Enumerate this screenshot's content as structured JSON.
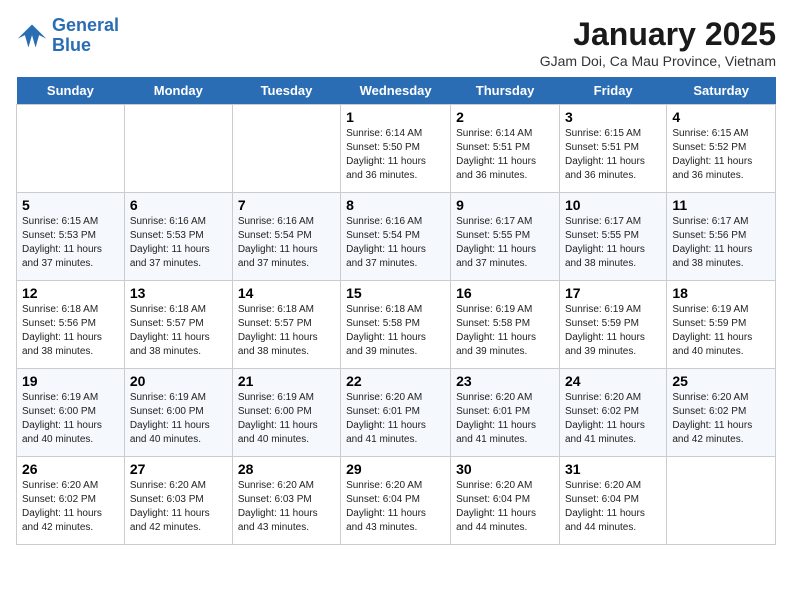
{
  "logo": {
    "line1": "General",
    "line2": "Blue"
  },
  "title": "January 2025",
  "location": "GJam Doi, Ca Mau Province, Vietnam",
  "headers": [
    "Sunday",
    "Monday",
    "Tuesday",
    "Wednesday",
    "Thursday",
    "Friday",
    "Saturday"
  ],
  "weeks": [
    [
      {
        "day": "",
        "text": ""
      },
      {
        "day": "",
        "text": ""
      },
      {
        "day": "",
        "text": ""
      },
      {
        "day": "1",
        "text": "Sunrise: 6:14 AM\nSunset: 5:50 PM\nDaylight: 11 hours and 36 minutes."
      },
      {
        "day": "2",
        "text": "Sunrise: 6:14 AM\nSunset: 5:51 PM\nDaylight: 11 hours and 36 minutes."
      },
      {
        "day": "3",
        "text": "Sunrise: 6:15 AM\nSunset: 5:51 PM\nDaylight: 11 hours and 36 minutes."
      },
      {
        "day": "4",
        "text": "Sunrise: 6:15 AM\nSunset: 5:52 PM\nDaylight: 11 hours and 36 minutes."
      }
    ],
    [
      {
        "day": "5",
        "text": "Sunrise: 6:15 AM\nSunset: 5:53 PM\nDaylight: 11 hours and 37 minutes."
      },
      {
        "day": "6",
        "text": "Sunrise: 6:16 AM\nSunset: 5:53 PM\nDaylight: 11 hours and 37 minutes."
      },
      {
        "day": "7",
        "text": "Sunrise: 6:16 AM\nSunset: 5:54 PM\nDaylight: 11 hours and 37 minutes."
      },
      {
        "day": "8",
        "text": "Sunrise: 6:16 AM\nSunset: 5:54 PM\nDaylight: 11 hours and 37 minutes."
      },
      {
        "day": "9",
        "text": "Sunrise: 6:17 AM\nSunset: 5:55 PM\nDaylight: 11 hours and 37 minutes."
      },
      {
        "day": "10",
        "text": "Sunrise: 6:17 AM\nSunset: 5:55 PM\nDaylight: 11 hours and 38 minutes."
      },
      {
        "day": "11",
        "text": "Sunrise: 6:17 AM\nSunset: 5:56 PM\nDaylight: 11 hours and 38 minutes."
      }
    ],
    [
      {
        "day": "12",
        "text": "Sunrise: 6:18 AM\nSunset: 5:56 PM\nDaylight: 11 hours and 38 minutes."
      },
      {
        "day": "13",
        "text": "Sunrise: 6:18 AM\nSunset: 5:57 PM\nDaylight: 11 hours and 38 minutes."
      },
      {
        "day": "14",
        "text": "Sunrise: 6:18 AM\nSunset: 5:57 PM\nDaylight: 11 hours and 38 minutes."
      },
      {
        "day": "15",
        "text": "Sunrise: 6:18 AM\nSunset: 5:58 PM\nDaylight: 11 hours and 39 minutes."
      },
      {
        "day": "16",
        "text": "Sunrise: 6:19 AM\nSunset: 5:58 PM\nDaylight: 11 hours and 39 minutes."
      },
      {
        "day": "17",
        "text": "Sunrise: 6:19 AM\nSunset: 5:59 PM\nDaylight: 11 hours and 39 minutes."
      },
      {
        "day": "18",
        "text": "Sunrise: 6:19 AM\nSunset: 5:59 PM\nDaylight: 11 hours and 40 minutes."
      }
    ],
    [
      {
        "day": "19",
        "text": "Sunrise: 6:19 AM\nSunset: 6:00 PM\nDaylight: 11 hours and 40 minutes."
      },
      {
        "day": "20",
        "text": "Sunrise: 6:19 AM\nSunset: 6:00 PM\nDaylight: 11 hours and 40 minutes."
      },
      {
        "day": "21",
        "text": "Sunrise: 6:19 AM\nSunset: 6:00 PM\nDaylight: 11 hours and 40 minutes."
      },
      {
        "day": "22",
        "text": "Sunrise: 6:20 AM\nSunset: 6:01 PM\nDaylight: 11 hours and 41 minutes."
      },
      {
        "day": "23",
        "text": "Sunrise: 6:20 AM\nSunset: 6:01 PM\nDaylight: 11 hours and 41 minutes."
      },
      {
        "day": "24",
        "text": "Sunrise: 6:20 AM\nSunset: 6:02 PM\nDaylight: 11 hours and 41 minutes."
      },
      {
        "day": "25",
        "text": "Sunrise: 6:20 AM\nSunset: 6:02 PM\nDaylight: 11 hours and 42 minutes."
      }
    ],
    [
      {
        "day": "26",
        "text": "Sunrise: 6:20 AM\nSunset: 6:02 PM\nDaylight: 11 hours and 42 minutes."
      },
      {
        "day": "27",
        "text": "Sunrise: 6:20 AM\nSunset: 6:03 PM\nDaylight: 11 hours and 42 minutes."
      },
      {
        "day": "28",
        "text": "Sunrise: 6:20 AM\nSunset: 6:03 PM\nDaylight: 11 hours and 43 minutes."
      },
      {
        "day": "29",
        "text": "Sunrise: 6:20 AM\nSunset: 6:04 PM\nDaylight: 11 hours and 43 minutes."
      },
      {
        "day": "30",
        "text": "Sunrise: 6:20 AM\nSunset: 6:04 PM\nDaylight: 11 hours and 44 minutes."
      },
      {
        "day": "31",
        "text": "Sunrise: 6:20 AM\nSunset: 6:04 PM\nDaylight: 11 hours and 44 minutes."
      },
      {
        "day": "",
        "text": ""
      }
    ]
  ]
}
